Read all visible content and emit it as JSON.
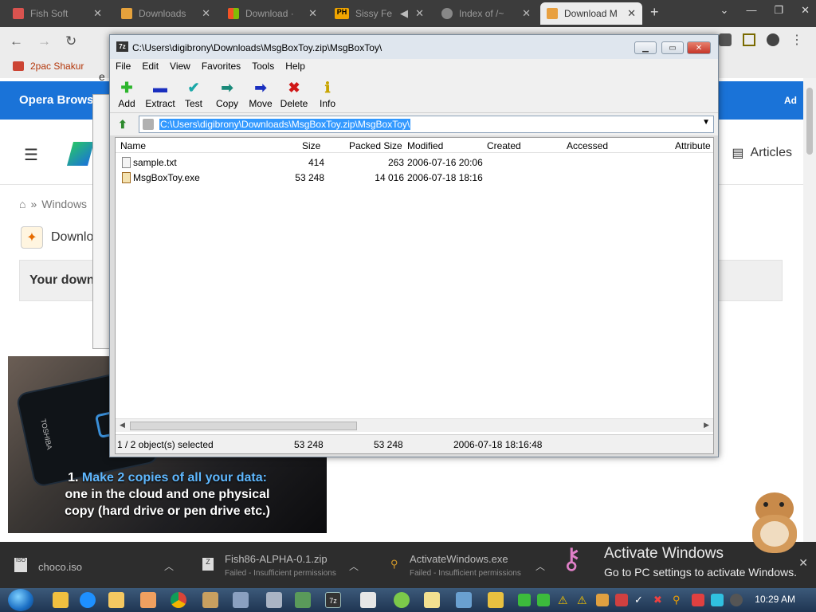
{
  "browser": {
    "tabs": [
      {
        "title": "Fish Soft",
        "favicon_color": "#d9534f"
      },
      {
        "title": "Downloads",
        "favicon_color": "#e6a23c"
      },
      {
        "title": "Download ·",
        "favicon_color": "#f35325"
      },
      {
        "title": "Sissy Fe",
        "favicon_color": "#f0a500",
        "favicon_text": "PH"
      },
      {
        "title": "Index of /~",
        "favicon_color": "#888888"
      },
      {
        "title": "Download M",
        "favicon_color": "#e8a040",
        "active": true
      }
    ],
    "bookmark": "2pac Shakur",
    "addr_partial": "e"
  },
  "page": {
    "ad_text": "Opera Brows",
    "ad_label": "Ad",
    "articles_label": "Articles",
    "breadcrumb": "Windows",
    "download_title": "Downlo",
    "download_box": "Your down",
    "video_caption_number": "1.",
    "video_caption_highlight": "Make 2 copies of all your data:",
    "video_caption_line2": "one in the cloud and one physical",
    "video_caption_line3": "copy (hard drive or pen drive etc.)",
    "video_brand": "TOSHIBA"
  },
  "zip": {
    "title": "C:\\Users\\digibrony\\Downloads\\MsgBoxToy.zip\\MsgBoxToy\\",
    "logo": "7z",
    "menu": [
      "File",
      "Edit",
      "View",
      "Favorites",
      "Tools",
      "Help"
    ],
    "toolbar": [
      {
        "label": "Add",
        "icon": "add-icon",
        "glyph": "+",
        "color": "#2db52d"
      },
      {
        "label": "Extract",
        "icon": "extract-icon",
        "glyph": "▬",
        "color": "#1a2fbf"
      },
      {
        "label": "Test",
        "icon": "test-icon",
        "glyph": "▼",
        "color": "#1aa8a8"
      },
      {
        "label": "Copy",
        "icon": "copy-icon",
        "glyph": "➡",
        "color": "#1a8a7a"
      },
      {
        "label": "Move",
        "icon": "move-icon",
        "glyph": "➡",
        "color": "#1a2fbf"
      },
      {
        "label": "Delete",
        "icon": "delete-icon",
        "glyph": "✖",
        "color": "#d01818"
      },
      {
        "label": "Info",
        "icon": "info-icon",
        "glyph": "ℹ",
        "color": "#c8a400"
      }
    ],
    "path": "C:\\Users\\digibrony\\Downloads\\MsgBoxToy.zip\\MsgBoxToy\\",
    "columns": [
      "Name",
      "Size",
      "Packed Size",
      "Modified",
      "Created",
      "Accessed",
      "Attribute"
    ],
    "files": [
      {
        "name": "sample.txt",
        "size": "414",
        "packed": "263",
        "modified": "2006-07-16 20:06",
        "type": "txt"
      },
      {
        "name": "MsgBoxToy.exe",
        "size": "53 248",
        "packed": "14 016",
        "modified": "2006-07-18 18:16",
        "type": "exe"
      }
    ],
    "status": {
      "selection": "1 / 2 object(s) selected",
      "size": "53 248",
      "packed": "53 248",
      "modified": "2006-07-18 18:16:48"
    }
  },
  "downloads": [
    {
      "name": "choco.iso",
      "sub": ""
    },
    {
      "name": "Fish86-ALPHA-0.1.zip",
      "sub": "Failed - Insufficient permissions"
    },
    {
      "name": "ActivateWindows.exe",
      "sub": "Failed - Insufficient permissions"
    }
  ],
  "watermark": {
    "line1": "Activate Windows",
    "line2": "Go to PC settings to activate Windows."
  },
  "taskbar": {
    "clock": "10:29 AM"
  }
}
